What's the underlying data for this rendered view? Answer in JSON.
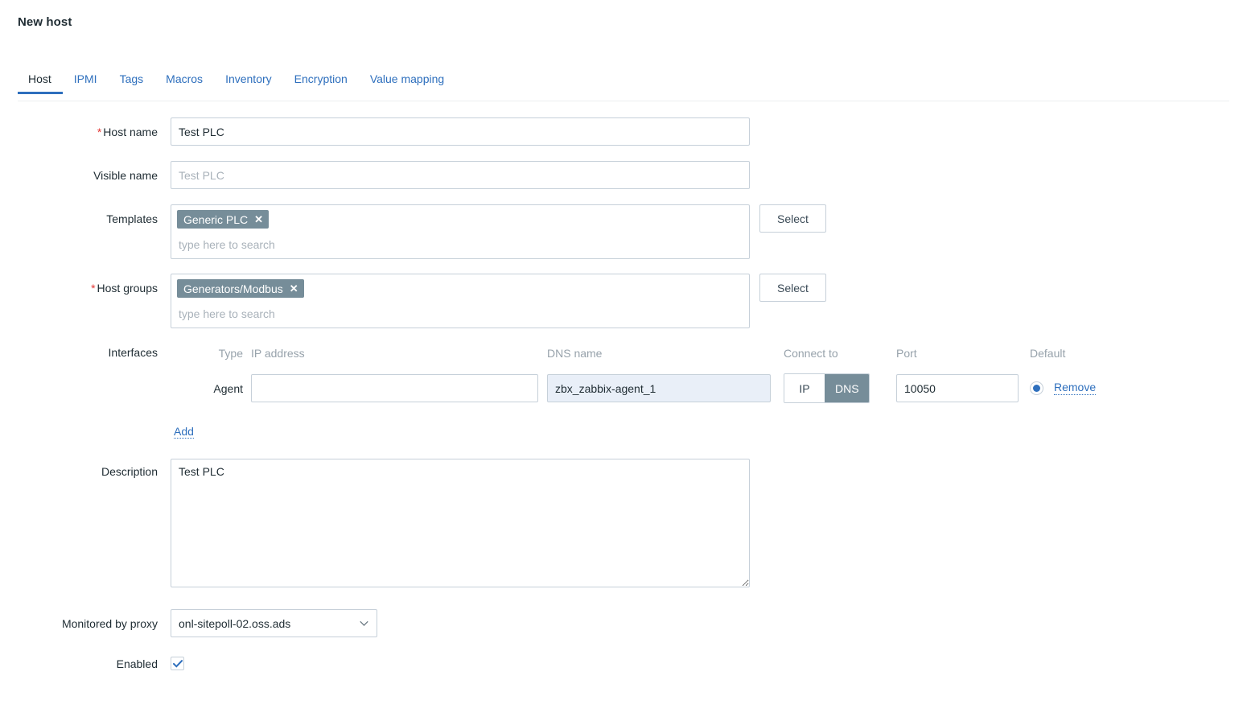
{
  "page": {
    "title": "New host"
  },
  "tabs": [
    {
      "label": "Host",
      "active": true
    },
    {
      "label": "IPMI",
      "active": false
    },
    {
      "label": "Tags",
      "active": false
    },
    {
      "label": "Macros",
      "active": false
    },
    {
      "label": "Inventory",
      "active": false
    },
    {
      "label": "Encryption",
      "active": false
    },
    {
      "label": "Value mapping",
      "active": false
    }
  ],
  "form": {
    "host_name": {
      "label": "Host name",
      "required": true,
      "required_mark": "*",
      "value": "Test PLC",
      "placeholder": ""
    },
    "visible_name": {
      "label": "Visible name",
      "required": false,
      "value": "",
      "placeholder": "Test PLC"
    },
    "templates": {
      "label": "Templates",
      "required": false,
      "chips": [
        {
          "text": "Generic PLC",
          "remove_glyph": "✕"
        }
      ],
      "search_placeholder": "type here to search",
      "select_button": "Select"
    },
    "host_groups": {
      "label": "Host groups",
      "required": true,
      "required_mark": "*",
      "chips": [
        {
          "text": "Generators/Modbus",
          "remove_glyph": "✕"
        }
      ],
      "search_placeholder": "type here to search",
      "select_button": "Select"
    },
    "interfaces": {
      "label": "Interfaces",
      "columns": {
        "type": "Type",
        "ip_address": "IP address",
        "dns_name": "DNS name",
        "connect_to": "Connect to",
        "port": "Port",
        "default": "Default"
      },
      "rows": [
        {
          "type": "Agent",
          "ip_value": "",
          "ip_placeholder": "",
          "dns_value": "zbx_zabbix-agent_1",
          "dns_placeholder": "",
          "connect_options": [
            {
              "label": "IP",
              "selected": false
            },
            {
              "label": "DNS",
              "selected": true
            }
          ],
          "port_value": "10050",
          "default_selected": true,
          "remove_link": "Remove"
        }
      ],
      "add_link": "Add"
    },
    "description": {
      "label": "Description",
      "value": "Test PLC",
      "placeholder": ""
    },
    "monitored_by_proxy": {
      "label": "Monitored by proxy",
      "selected": "onl-sitepoll-02.oss.ads",
      "options": [
        "onl-sitepoll-02.oss.ads"
      ]
    },
    "enabled": {
      "label": "Enabled",
      "checked": true,
      "check_glyph": "✔"
    }
  },
  "colors": {
    "accent_blue": "#2e6fbd",
    "chip_gray": "#768d99",
    "required_red": "#e33734",
    "border_gray": "#c6d0d9",
    "muted_text": "#97a2ab",
    "active_field_bg": "#e9eff8",
    "text": "#1f2c33"
  }
}
